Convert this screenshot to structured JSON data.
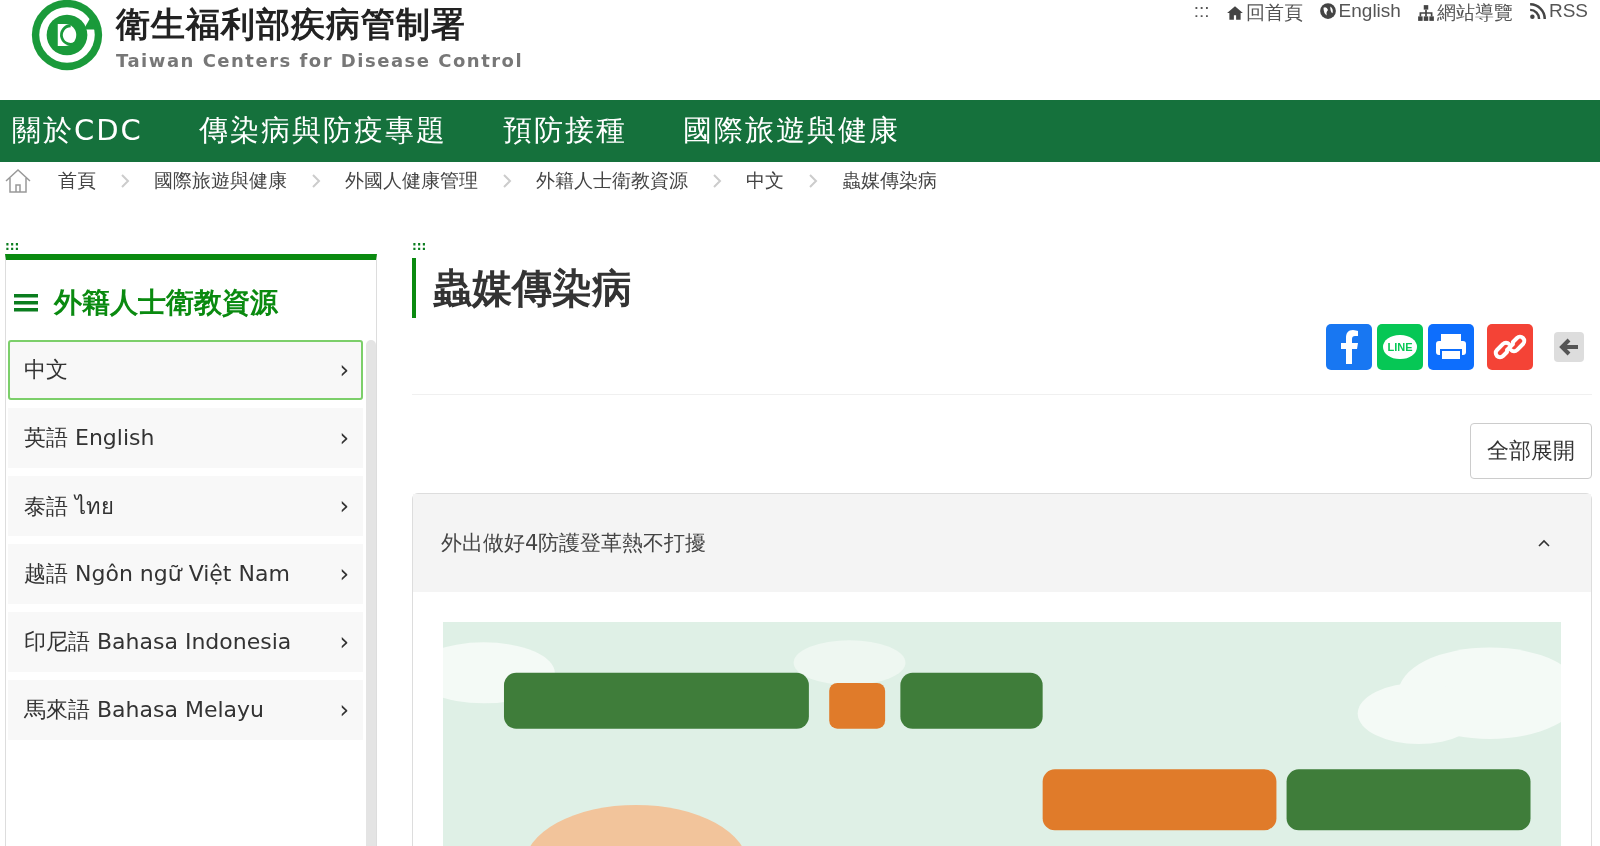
{
  "header": {
    "title": "衛生福利部疾病管制署",
    "subtitle": "Taiwan Centers for Disease Control",
    "links": [
      {
        "kind": "accesskey",
        "label": ":::"
      },
      {
        "kind": "home",
        "label": "回首頁"
      },
      {
        "kind": "globe",
        "label": "English"
      },
      {
        "kind": "sitemap",
        "label": "網站導覽"
      },
      {
        "kind": "rss",
        "label": "RSS"
      }
    ]
  },
  "nav": [
    "關於CDC",
    "傳染病與防疫專題",
    "預防接種",
    "國際旅遊與健康"
  ],
  "breadcrumb": [
    "首頁",
    "國際旅遊與健康",
    "外國人健康管理",
    "外籍人士衛教資源",
    "中文",
    "蟲媒傳染病"
  ],
  "sidebar": {
    "anchor": ":::",
    "title": "外籍人士衛教資源",
    "items": [
      {
        "label": "中文",
        "arrow": "›",
        "selected": true
      },
      {
        "label": "英語 English",
        "arrow": "›",
        "selected": false
      },
      {
        "label": "泰語 ไทย",
        "arrow": "›",
        "selected": false
      },
      {
        "label": "越語 Ngôn ngữ Việt Nam",
        "arrow": "›",
        "selected": false
      },
      {
        "label": "印尼語 Bahasa Indonesia",
        "arrow": "›",
        "selected": false
      },
      {
        "label": "馬來語 Bahasa Melayu",
        "arrow": "›",
        "selected": false
      }
    ]
  },
  "main": {
    "anchor": ":::",
    "title": "蟲媒傳染病",
    "share": [
      {
        "kind": "facebook"
      },
      {
        "kind": "line",
        "label": "LINE"
      },
      {
        "kind": "print"
      },
      {
        "kind": "link"
      },
      {
        "kind": "back"
      }
    ],
    "expand_button": "全部展開",
    "accordion": [
      {
        "title": "外出做好4防護登革熱不打擾",
        "expanded": true
      }
    ]
  }
}
